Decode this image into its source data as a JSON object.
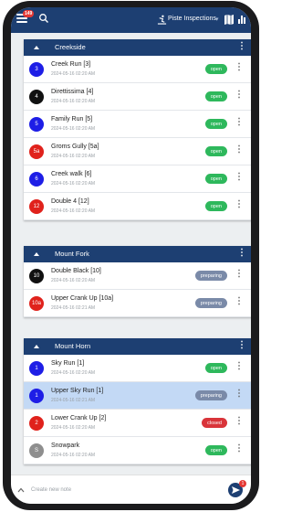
{
  "header": {
    "menu_badge": "149",
    "title": "Piste Inspections"
  },
  "sections": [
    {
      "name": "Creekside",
      "items": [
        {
          "num": "3",
          "color": "#1e1ee6",
          "title": "Creek Run [3]",
          "time": "2024-05-16 02:20 AM",
          "status": "open",
          "status_color": "#2eb85c"
        },
        {
          "num": "4",
          "color": "#111111",
          "title": "Direttissima [4]",
          "time": "2024-05-16 02:20 AM",
          "status": "open",
          "status_color": "#2eb85c"
        },
        {
          "num": "5",
          "color": "#1e1ee6",
          "title": "Family Run [5]",
          "time": "2024-05-16 02:20 AM",
          "status": "open",
          "status_color": "#2eb85c"
        },
        {
          "num": "5a",
          "color": "#e0221c",
          "title": "Groms Gully [5a]",
          "time": "2024-05-16 02:20 AM",
          "status": "open",
          "status_color": "#2eb85c"
        },
        {
          "num": "6",
          "color": "#1e1ee6",
          "title": "Creek walk [6]",
          "time": "2024-05-16 02:20 AM",
          "status": "open",
          "status_color": "#2eb85c"
        },
        {
          "num": "12",
          "color": "#e0221c",
          "title": "Double 4 [12]",
          "time": "2024-05-16 02:20 AM",
          "status": "open",
          "status_color": "#2eb85c"
        }
      ]
    },
    {
      "name": "Mount Fork",
      "items": [
        {
          "num": "10",
          "color": "#111111",
          "title": "Double Black [10]",
          "time": "2024-05-16 02:20 AM",
          "status": "preparing",
          "status_color": "#7a8aa8"
        },
        {
          "num": "10a",
          "color": "#e0221c",
          "title": "Upper Crank Up [10a]",
          "time": "2024-05-16 02:21 AM",
          "status": "preparing",
          "status_color": "#7a8aa8"
        }
      ]
    },
    {
      "name": "Mount Horn",
      "items": [
        {
          "num": "1",
          "color": "#1e1ee6",
          "title": "Sky Run [1]",
          "time": "2024-05-16 02:20 AM",
          "status": "open",
          "status_color": "#2eb85c"
        },
        {
          "num": "1",
          "color": "#1e1ee6",
          "title": "Upper Sky Run [1]",
          "time": "2024-05-16 02:21 AM",
          "status": "preparing",
          "status_color": "#7a8aa8",
          "highlighted": true
        },
        {
          "num": "2",
          "color": "#e0221c",
          "title": "Lower Crank Up [2]",
          "time": "2024-05-16 02:20 AM",
          "status": "closed",
          "status_color": "#d9343a"
        },
        {
          "num": "S",
          "color": "#8e8e8e",
          "title": "Snowpark",
          "time": "2024-05-16 02:20 AM",
          "status": "open",
          "status_color": "#2eb85c"
        }
      ]
    }
  ],
  "note": {
    "placeholder": "Create new note",
    "badge": "1"
  }
}
